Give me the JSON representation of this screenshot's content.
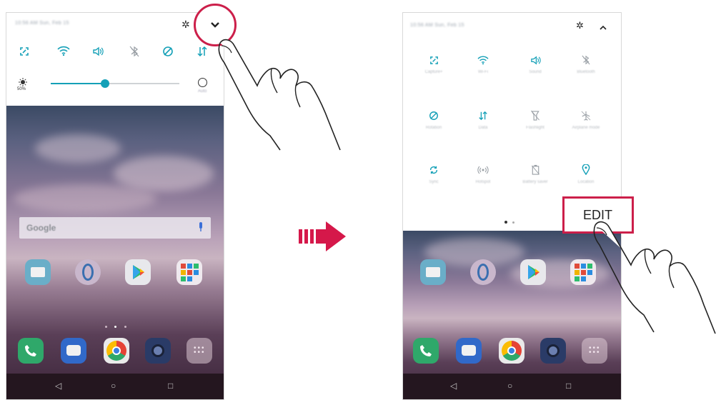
{
  "left_phone": {
    "status_text": "10:56 AM Sun, Feb 15",
    "brightness_value": "50%",
    "brightness_level": 0.42,
    "search_placeholder": "Google",
    "auto_label": "Auto",
    "quick_icons": [
      "capture-icon",
      "wifi-icon",
      "sound-icon",
      "bluetooth-icon",
      "rotation-icon",
      "data-icon"
    ],
    "home_apps": [
      "E-mail",
      "Gallery",
      "Play Store",
      "Google"
    ],
    "dock_apps": [
      "Phone",
      "Messaging",
      "Chrome",
      "Camera",
      "Apps"
    ]
  },
  "arrow_label": "",
  "right_phone": {
    "status_text": "10:56 AM Sun, Feb 15",
    "tiles": [
      {
        "icon": "capture-icon",
        "label": "Capture+"
      },
      {
        "icon": "wifi-icon",
        "label": "Wi-Fi"
      },
      {
        "icon": "sound-icon",
        "label": "Sound"
      },
      {
        "icon": "bluetooth-icon",
        "label": "Bluetooth"
      },
      {
        "icon": "rotation-icon",
        "label": "Rotation"
      },
      {
        "icon": "data-icon",
        "label": "Data"
      },
      {
        "icon": "flashlight-icon",
        "label": "Flashlight"
      },
      {
        "icon": "airplane-icon",
        "label": "Airplane mode"
      },
      {
        "icon": "sync-icon",
        "label": "Sync"
      },
      {
        "icon": "hotspot-icon",
        "label": "Hotspot"
      },
      {
        "icon": "battery-saver-icon",
        "label": "Battery saver"
      },
      {
        "icon": "location-icon",
        "label": "Location"
      }
    ],
    "edit_label": "EDIT",
    "page_dots": 2
  },
  "colors": {
    "accent": "#14a0b7",
    "highlight": "#cc1f4a",
    "arrow": "#d5184a"
  }
}
